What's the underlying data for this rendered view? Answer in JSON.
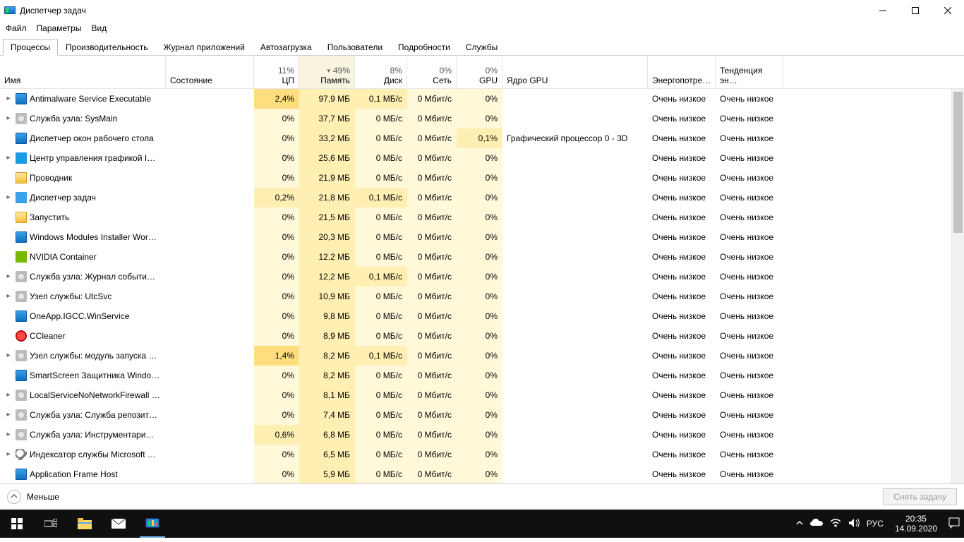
{
  "window": {
    "title": "Диспетчер задач"
  },
  "menu": {
    "file": "Файл",
    "options": "Параметры",
    "view": "Вид"
  },
  "tabs": [
    "Процессы",
    "Производительность",
    "Журнал приложений",
    "Автозагрузка",
    "Пользователи",
    "Подробности",
    "Службы"
  ],
  "active_tab": 0,
  "columns": {
    "name": "Имя",
    "status": "Состояние",
    "cpu": {
      "pct": "11%",
      "label": "ЦП"
    },
    "mem": {
      "pct": "49%",
      "label": "Память"
    },
    "disk": {
      "pct": "8%",
      "label": "Диск"
    },
    "net": {
      "pct": "0%",
      "label": "Сеть"
    },
    "gpu": {
      "pct": "0%",
      "label": "GPU"
    },
    "gpu_engine": "Ядро GPU",
    "power": "Энергопотре…",
    "power_trend": "Тенденция эн…"
  },
  "rows": [
    {
      "exp": true,
      "icon": "blue",
      "name": "Antimalware Service Executable",
      "cpu": "2,4%",
      "mem": "97,9 МБ",
      "disk": "0,1 МБ/с",
      "net": "0 Мбит/с",
      "gpu": "0%",
      "eng": "",
      "pw": "Очень низкое",
      "tr": "Очень низкое",
      "cpu_hl": "hi",
      "disk_hl": "med"
    },
    {
      "exp": true,
      "icon": "gear",
      "name": "Служба узла: SysMain",
      "cpu": "0%",
      "mem": "37,7 МБ",
      "disk": "0 МБ/с",
      "net": "0 Мбит/с",
      "gpu": "0%",
      "eng": "",
      "pw": "Очень низкое",
      "tr": "Очень низкое"
    },
    {
      "exp": false,
      "icon": "blue",
      "name": "Диспетчер окон рабочего стола",
      "cpu": "0%",
      "mem": "33,2 МБ",
      "disk": "0 МБ/с",
      "net": "0 Мбит/с",
      "gpu": "0,1%",
      "eng": "Графический процессор 0 - 3D",
      "pw": "Очень низкое",
      "tr": "Очень низкое",
      "gpu_hl": "med"
    },
    {
      "exp": true,
      "icon": "intel",
      "name": "Центр управления графикой I…",
      "cpu": "0%",
      "mem": "25,6 МБ",
      "disk": "0 МБ/с",
      "net": "0 Мбит/с",
      "gpu": "0%",
      "eng": "",
      "pw": "Очень низкое",
      "tr": "Очень низкое"
    },
    {
      "exp": false,
      "icon": "folder",
      "name": "Проводник",
      "cpu": "0%",
      "mem": "21,9 МБ",
      "disk": "0 МБ/с",
      "net": "0 Мбит/с",
      "gpu": "0%",
      "eng": "",
      "pw": "Очень низкое",
      "tr": "Очень низкое"
    },
    {
      "exp": true,
      "icon": "net",
      "name": "Диспетчер задач",
      "cpu": "0,2%",
      "mem": "21,8 МБ",
      "disk": "0,1 МБ/с",
      "net": "0 Мбит/с",
      "gpu": "0%",
      "eng": "",
      "pw": "Очень низкое",
      "tr": "Очень низкое",
      "cpu_hl": "med",
      "disk_hl": "med"
    },
    {
      "exp": false,
      "icon": "folder",
      "name": "Запустить",
      "cpu": "0%",
      "mem": "21,5 МБ",
      "disk": "0 МБ/с",
      "net": "0 Мбит/с",
      "gpu": "0%",
      "eng": "",
      "pw": "Очень низкое",
      "tr": "Очень низкое"
    },
    {
      "exp": false,
      "icon": "blue",
      "name": "Windows Modules Installer Wor…",
      "cpu": "0%",
      "mem": "20,3 МБ",
      "disk": "0 МБ/с",
      "net": "0 Мбит/с",
      "gpu": "0%",
      "eng": "",
      "pw": "Очень низкое",
      "tr": "Очень низкое"
    },
    {
      "exp": false,
      "icon": "nvidia",
      "name": "NVIDIA Container",
      "cpu": "0%",
      "mem": "12,2 МБ",
      "disk": "0 МБ/с",
      "net": "0 Мбит/с",
      "gpu": "0%",
      "eng": "",
      "pw": "Очень низкое",
      "tr": "Очень низкое"
    },
    {
      "exp": true,
      "icon": "gear",
      "name": "Служба узла: Журнал событи…",
      "cpu": "0%",
      "mem": "12,2 МБ",
      "disk": "0,1 МБ/с",
      "net": "0 Мбит/с",
      "gpu": "0%",
      "eng": "",
      "pw": "Очень низкое",
      "tr": "Очень низкое",
      "disk_hl": "med"
    },
    {
      "exp": true,
      "icon": "gear",
      "name": "Узел службы: UtcSvc",
      "cpu": "0%",
      "mem": "10,9 МБ",
      "disk": "0 МБ/с",
      "net": "0 Мбит/с",
      "gpu": "0%",
      "eng": "",
      "pw": "Очень низкое",
      "tr": "Очень низкое"
    },
    {
      "exp": false,
      "icon": "blue",
      "name": "OneApp.IGCC.WinService",
      "cpu": "0%",
      "mem": "9,8 МБ",
      "disk": "0 МБ/с",
      "net": "0 Мбит/с",
      "gpu": "0%",
      "eng": "",
      "pw": "Очень низкое",
      "tr": "Очень низкое"
    },
    {
      "exp": false,
      "icon": "cc",
      "name": "CCleaner",
      "cpu": "0%",
      "mem": "8,9 МБ",
      "disk": "0 МБ/с",
      "net": "0 Мбит/с",
      "gpu": "0%",
      "eng": "",
      "pw": "Очень низкое",
      "tr": "Очень низкое"
    },
    {
      "exp": true,
      "icon": "gear",
      "name": "Узел службы: модуль запуска …",
      "cpu": "1,4%",
      "mem": "8,2 МБ",
      "disk": "0,1 МБ/с",
      "net": "0 Мбит/с",
      "gpu": "0%",
      "eng": "",
      "pw": "Очень низкое",
      "tr": "Очень низкое",
      "cpu_hl": "hi",
      "disk_hl": "med"
    },
    {
      "exp": false,
      "icon": "blue",
      "name": "SmartScreen Защитника Windo…",
      "cpu": "0%",
      "mem": "8,2 МБ",
      "disk": "0 МБ/с",
      "net": "0 Мбит/с",
      "gpu": "0%",
      "eng": "",
      "pw": "Очень низкое",
      "tr": "Очень низкое"
    },
    {
      "exp": true,
      "icon": "gear",
      "name": "LocalServiceNoNetworkFirewall …",
      "cpu": "0%",
      "mem": "8,1 МБ",
      "disk": "0 МБ/с",
      "net": "0 Мбит/с",
      "gpu": "0%",
      "eng": "",
      "pw": "Очень низкое",
      "tr": "Очень низкое"
    },
    {
      "exp": true,
      "icon": "gear",
      "name": "Служба узла: Служба репозит…",
      "cpu": "0%",
      "mem": "7,4 МБ",
      "disk": "0 МБ/с",
      "net": "0 Мбит/с",
      "gpu": "0%",
      "eng": "",
      "pw": "Очень низкое",
      "tr": "Очень низкое"
    },
    {
      "exp": true,
      "icon": "gear",
      "name": "Служба узла: Инструментари…",
      "cpu": "0,6%",
      "mem": "6,8 МБ",
      "disk": "0 МБ/с",
      "net": "0 Мбит/с",
      "gpu": "0%",
      "eng": "",
      "pw": "Очень низкое",
      "tr": "Очень низкое",
      "cpu_hl": "med"
    },
    {
      "exp": true,
      "icon": "search",
      "name": "Индексатор службы Microsoft …",
      "cpu": "0%",
      "mem": "6,5 МБ",
      "disk": "0 МБ/с",
      "net": "0 Мбит/с",
      "gpu": "0%",
      "eng": "",
      "pw": "Очень низкое",
      "tr": "Очень низкое"
    },
    {
      "exp": false,
      "icon": "blue",
      "name": "Application Frame Host",
      "cpu": "0%",
      "mem": "5,9 МБ",
      "disk": "0 МБ/с",
      "net": "0 Мбит/с",
      "gpu": "0%",
      "eng": "",
      "pw": "Очень низкое",
      "tr": "Очень низкое"
    }
  ],
  "footer": {
    "less": "Меньше",
    "end_task": "Снять задачу"
  },
  "taskbar": {
    "lang": "РУС",
    "time": "20:35",
    "date": "14.09.2020"
  },
  "col_widths": {
    "name": 235,
    "status": 125,
    "cpu": 64,
    "mem": 79,
    "disk": 74,
    "net": 70,
    "gpu": 65,
    "eng": 206,
    "pw": 96,
    "tr": 96
  }
}
